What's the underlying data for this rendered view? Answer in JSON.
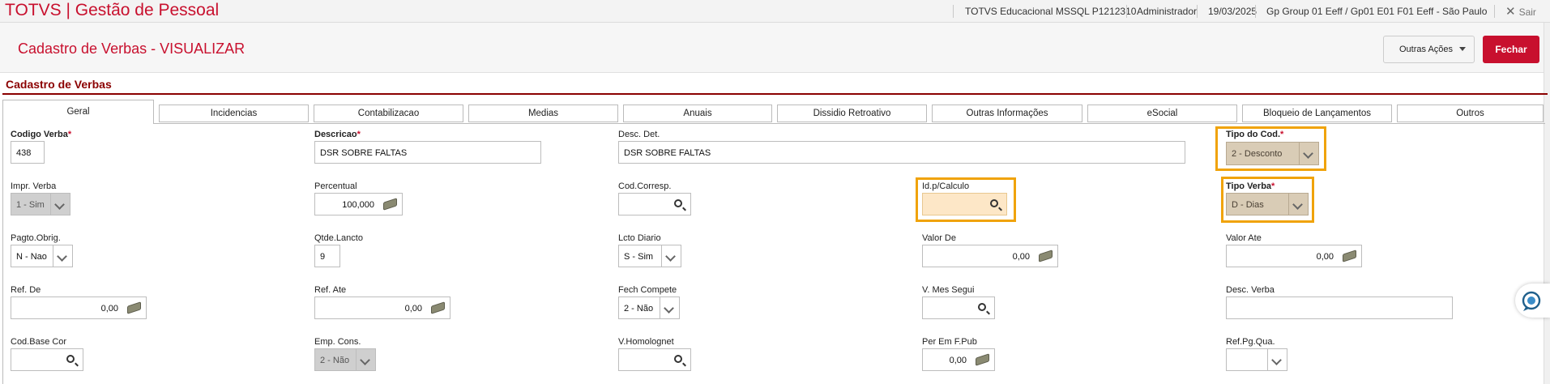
{
  "app": {
    "title": "TOTVS | Gestão de Pessoal"
  },
  "topbar": {
    "environment": "TOTVS Educacional MSSQL P1212310",
    "user": "Administrador",
    "date": "19/03/2025",
    "branch": "Gp Group 01 Eeff / Gp01 E01 F01 Eeff - São Paulo",
    "exit_label": "Sair"
  },
  "header": {
    "title": "Cadastro de Verbas - VISUALIZAR",
    "other_actions_label": "Outras Ações",
    "close_label": "Fechar"
  },
  "section": {
    "title": "Cadastro de Verbas"
  },
  "tabs": [
    {
      "label": "Geral"
    },
    {
      "label": "Incidencias"
    },
    {
      "label": "Contabilizacao"
    },
    {
      "label": "Medias"
    },
    {
      "label": "Anuais"
    },
    {
      "label": "Dissidio Retroativo"
    },
    {
      "label": "Outras Informações"
    },
    {
      "label": "eSocial"
    },
    {
      "label": "Bloqueio de Lançamentos"
    },
    {
      "label": "Outros"
    }
  ],
  "fields": {
    "codigo_verba": {
      "label": "Codigo Verba",
      "value": "438"
    },
    "descricao": {
      "label": "Descricao",
      "value": "DSR SOBRE FALTAS"
    },
    "desc_det": {
      "label": "Desc. Det.",
      "value": "DSR SOBRE FALTAS"
    },
    "tipo_cod": {
      "label": "Tipo do Cod.",
      "value": "2 - Desconto"
    },
    "impr_verba": {
      "label": "Impr. Verba",
      "value": "1 - Sim"
    },
    "percentual": {
      "label": "Percentual",
      "value": "100,000"
    },
    "cod_corresp": {
      "label": "Cod.Corresp.",
      "value": ""
    },
    "id_calculo": {
      "label": "Id.p/Calculo",
      "value": ""
    },
    "tipo_verba": {
      "label": "Tipo Verba",
      "value": "D - Dias"
    },
    "pagto_obrig": {
      "label": "Pagto.Obrig.",
      "value": "N - Nao"
    },
    "qtde_lancto": {
      "label": "Qtde.Lancto",
      "value": "9"
    },
    "lcto_diario": {
      "label": "Lcto Diario",
      "value": "S - Sim"
    },
    "valor_de": {
      "label": "Valor De",
      "value": "0,00"
    },
    "valor_ate": {
      "label": "Valor Ate",
      "value": "0,00"
    },
    "ref_de": {
      "label": "Ref. De",
      "value": "0,00"
    },
    "ref_ate": {
      "label": "Ref. Ate",
      "value": "0,00"
    },
    "fech_compete": {
      "label": "Fech Compete",
      "value": "2 - Não"
    },
    "v_mes_segui": {
      "label": "V. Mes Segui",
      "value": ""
    },
    "desc_verba": {
      "label": "Desc. Verba",
      "value": ""
    },
    "cod_base_cor": {
      "label": "Cod.Base Cor",
      "value": ""
    },
    "emp_cons": {
      "label": "Emp. Cons.",
      "value": "2 - Não"
    },
    "v_homolognet": {
      "label": "V.Homolognet",
      "value": ""
    },
    "per_em_f_pub": {
      "label": "Per Em F.Pub",
      "value": "0,00"
    },
    "ref_pg_qua": {
      "label": "Ref.Pg.Qua.",
      "value": ""
    }
  },
  "required_marker": "*",
  "colors": {
    "brand": "#c8102e",
    "highlight": "#f0a30a",
    "section": "#8b0000"
  }
}
